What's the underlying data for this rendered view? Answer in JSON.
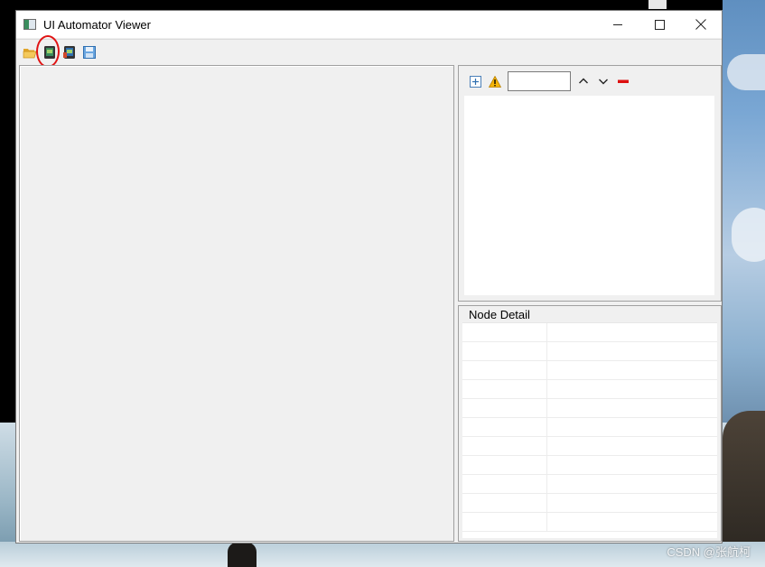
{
  "window": {
    "title": "UI Automator Viewer"
  },
  "titlebar_controls": [
    "minimize",
    "maximize",
    "close"
  ],
  "toolbar": {
    "buttons": [
      {
        "icon": "open-folder-icon"
      },
      {
        "icon": "device-screenshot-icon",
        "highlighted": true
      },
      {
        "icon": "device-screenshot-compressed-icon"
      },
      {
        "icon": "save-icon"
      }
    ],
    "highlight_color": "#e01414"
  },
  "hierarchy_toolbar": {
    "buttons": [
      {
        "icon": "expand-all-icon"
      },
      {
        "icon": "warning-icon"
      }
    ],
    "search": {
      "value": "",
      "placeholder": ""
    },
    "nav_buttons": [
      {
        "icon": "chevron-up-icon"
      },
      {
        "icon": "chevron-down-icon"
      },
      {
        "icon": "clear-icon"
      }
    ]
  },
  "node_detail": {
    "label": "Node Detail",
    "rows": [
      {
        "key": "",
        "value": ""
      },
      {
        "key": "",
        "value": ""
      },
      {
        "key": "",
        "value": ""
      },
      {
        "key": "",
        "value": ""
      },
      {
        "key": "",
        "value": ""
      },
      {
        "key": "",
        "value": ""
      },
      {
        "key": "",
        "value": ""
      },
      {
        "key": "",
        "value": ""
      },
      {
        "key": "",
        "value": ""
      },
      {
        "key": "",
        "value": ""
      },
      {
        "key": "",
        "value": ""
      }
    ]
  },
  "watermark": "CSDN @张航柯",
  "colors": {
    "window_bg": "#f0f0f0",
    "titlebar_bg": "#ffffff",
    "panel_border": "#a0a0a0",
    "clear_red": "#dd1111"
  }
}
